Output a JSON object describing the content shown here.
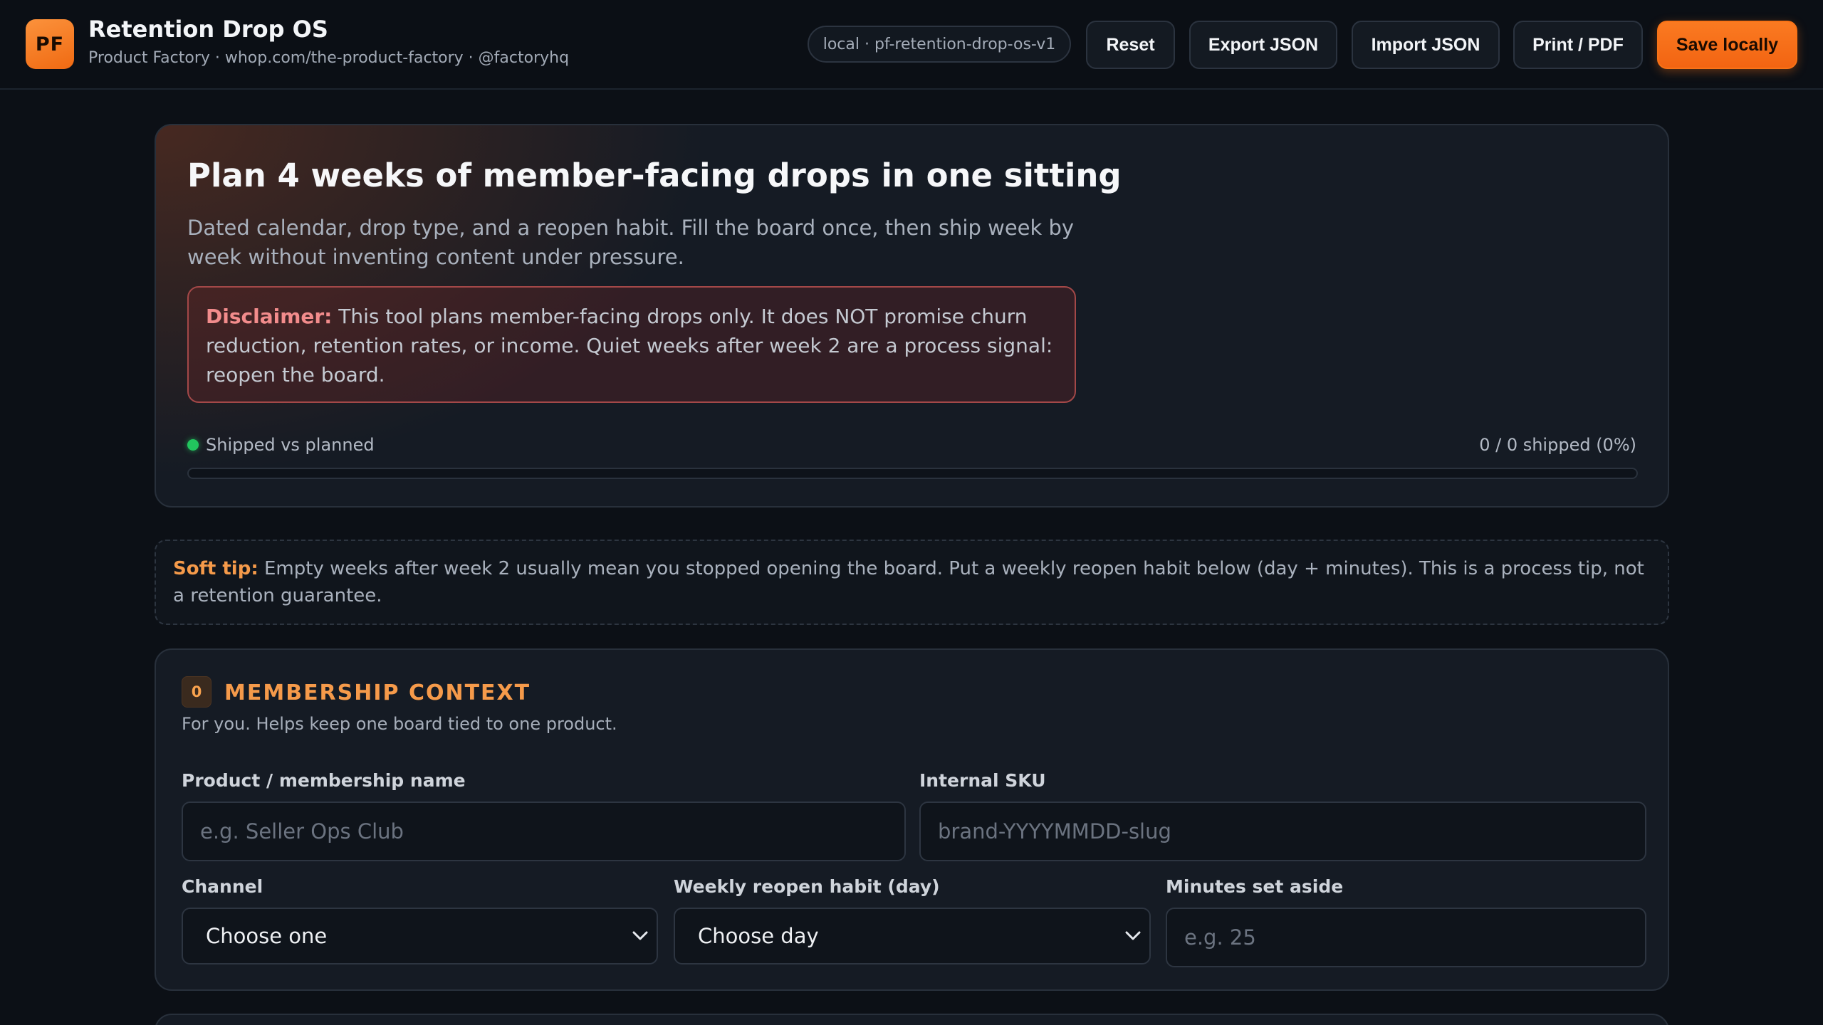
{
  "app": {
    "logo_text": "PF",
    "title": "Retention Drop OS",
    "subtitle": "Product Factory · whop.com/the-product-factory · @factoryhq",
    "storage_key": "local · pf-retention-drop-os-v1"
  },
  "toolbar": {
    "reset_label": "Reset",
    "export_label": "Export JSON",
    "import_label": "Import JSON",
    "print_label": "Print / PDF",
    "save_label": "Save locally"
  },
  "hero": {
    "title": "Plan 4 weeks of member-facing drops in one sitting",
    "description": "Dated calendar, drop type, and a reopen habit. Fill the board once, then ship week by week without inventing content under pressure.",
    "disclaimer_label": "Disclaimer:",
    "disclaimer_text": " This tool plans member-facing drops only. It does NOT promise churn reduction, retention rates, or income. Quiet weeks after week 2 are a process signal: reopen the board.",
    "progress_label": "Shipped vs planned",
    "progress_count": "0 / 0 shipped (0%)",
    "progress_fraction": 0
  },
  "tip": {
    "label": "Soft tip:",
    "text": " Empty weeks after week 2 usually mean you stopped opening the board. Put a weekly reopen habit below (day + minutes). This is a process tip, not a retention guarantee."
  },
  "section": {
    "step": "0",
    "title": "MEMBERSHIP CONTEXT",
    "subtitle": "For you. Helps keep one board tied to one product.",
    "fields": {
      "product_name_label": "Product / membership name",
      "product_name_placeholder": "e.g. Seller Ops Club",
      "sku_label": "Internal SKU",
      "sku_placeholder": "brand-YYYYMMDD-slug",
      "channel_label": "Channel",
      "channel_value": "Choose one",
      "habit_day_label": "Weekly reopen habit (day)",
      "habit_day_value": "Choose day",
      "minutes_label": "Minutes set aside",
      "minutes_placeholder": "e.g. 25"
    }
  },
  "colors": {
    "accent": "#f97316",
    "progress": "#22c55e",
    "disclaimer": "#f28c8c"
  }
}
